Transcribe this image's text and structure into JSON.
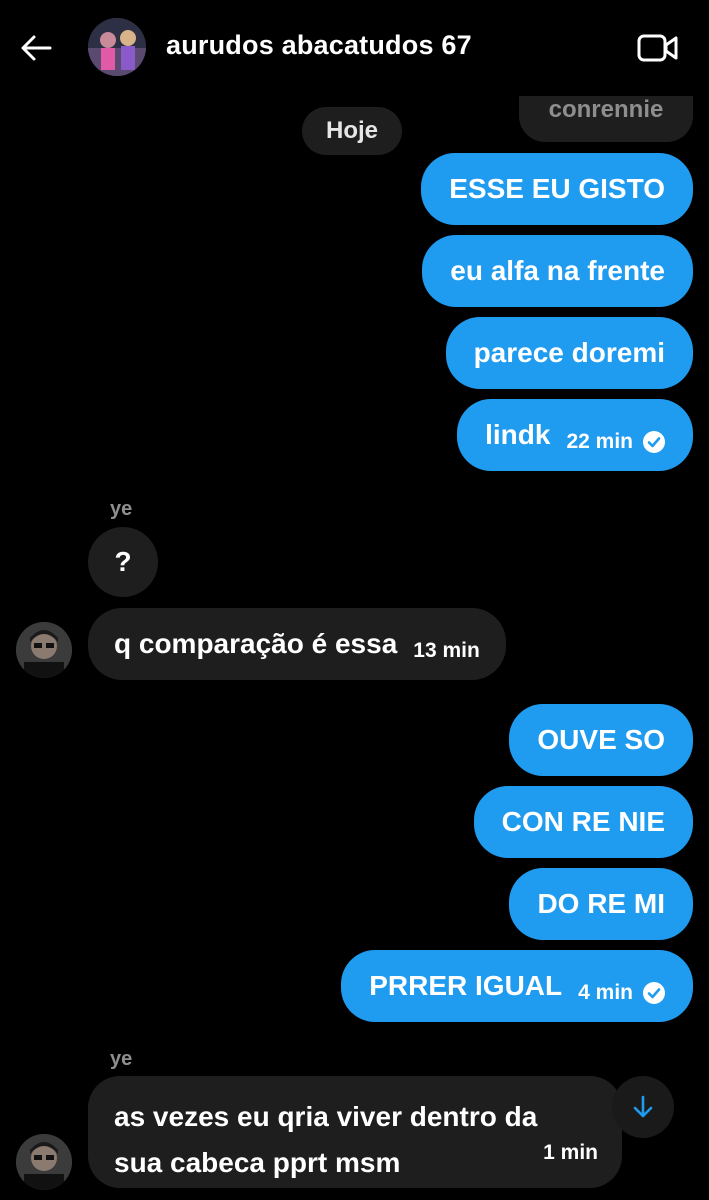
{
  "header": {
    "title": "aurudos abacatudos 67",
    "back_icon": "arrow-left-icon",
    "video_icon": "video-call-icon"
  },
  "quoted_reply": "conrennie",
  "date_divider": "Hoje",
  "messages_out_1": [
    {
      "text": "ESSE EU GISTO"
    },
    {
      "text": "eu alfa na frente"
    },
    {
      "text": "parece doremi"
    },
    {
      "text": "lindk",
      "time": "22 min",
      "status_icon": "check-circle-icon"
    }
  ],
  "incoming_1": {
    "sender": "ye",
    "messages": [
      {
        "text": "?"
      },
      {
        "text": "q comparação é essa",
        "time": "13 min"
      }
    ]
  },
  "messages_out_2": [
    {
      "text": "OUVE SO"
    },
    {
      "text": "CON RE NIE"
    },
    {
      "text": "DO RE MI"
    },
    {
      "text": "PRRER IGUAL",
      "time": "4 min",
      "status_icon": "check-circle-icon"
    }
  ],
  "incoming_2": {
    "sender": "ye",
    "message": {
      "line1": "as vezes eu qria viver dentro da",
      "line2": "sua cabeca pprt msm",
      "time": "1 min"
    }
  },
  "colors": {
    "outgoing_bubble": "#1f9bef",
    "incoming_bubble": "#1e1e1e",
    "background": "#000000"
  }
}
